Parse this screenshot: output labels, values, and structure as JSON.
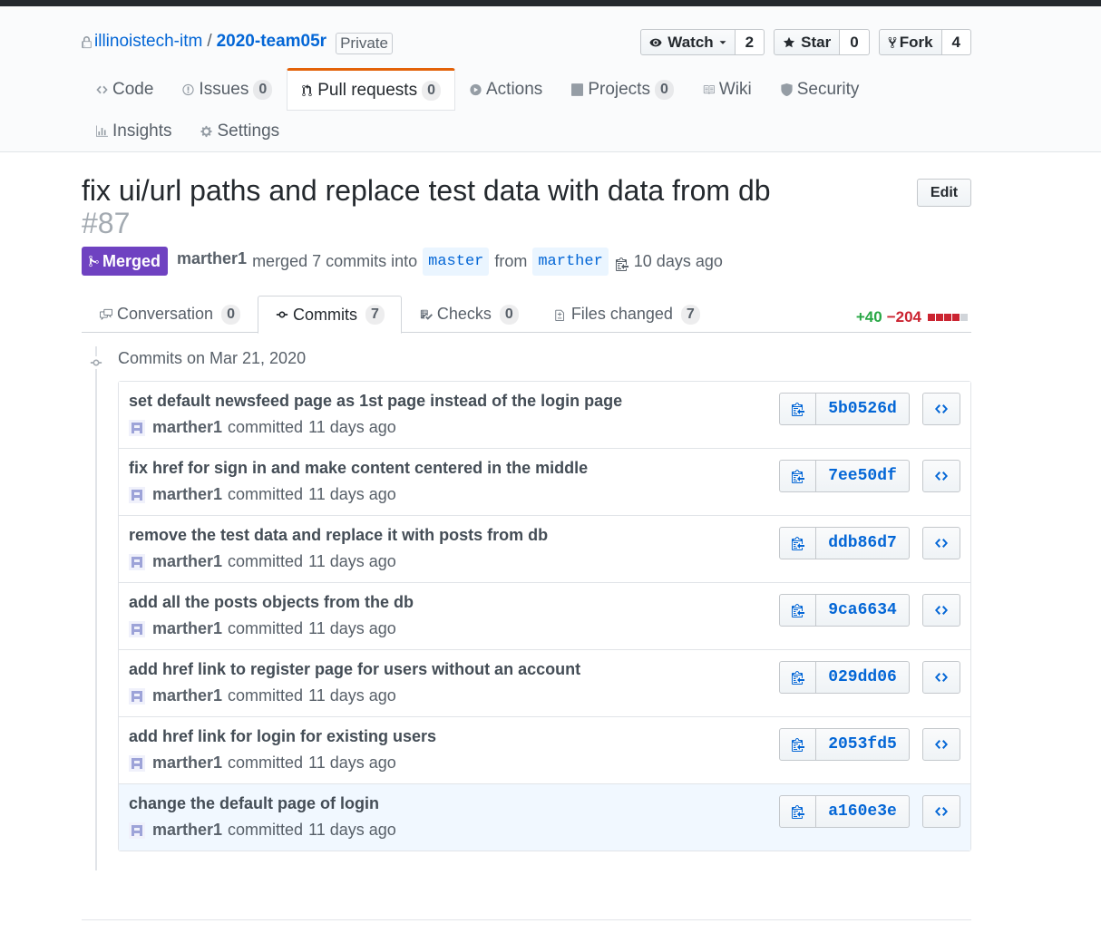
{
  "repo": {
    "owner": "illinoistech-itm",
    "separator": "/",
    "name": "2020-team05r",
    "visibility": "Private"
  },
  "social": {
    "watch": {
      "label": "Watch",
      "count": "2"
    },
    "star": {
      "label": "Star",
      "count": "0"
    },
    "fork": {
      "label": "Fork",
      "count": "4"
    }
  },
  "nav": {
    "code": "Code",
    "issues": {
      "label": "Issues",
      "count": "0"
    },
    "pulls": {
      "label": "Pull requests",
      "count": "0"
    },
    "actions": "Actions",
    "projects": {
      "label": "Projects",
      "count": "0"
    },
    "wiki": "Wiki",
    "security": "Security",
    "insights": "Insights",
    "settings": "Settings"
  },
  "pr": {
    "title": "fix ui/url paths and replace test data with data from db",
    "number": "#87",
    "edit_label": "Edit",
    "state": "Merged",
    "author": "marther1",
    "merged_text": "merged 7 commits into",
    "base_branch": "master",
    "from_text": "from",
    "head_branch": "marther",
    "time_ago": "10 days ago"
  },
  "tabs": {
    "conversation": {
      "label": "Conversation",
      "count": "0"
    },
    "commits": {
      "label": "Commits",
      "count": "7"
    },
    "checks": {
      "label": "Checks",
      "count": "0"
    },
    "files": {
      "label": "Files changed",
      "count": "7"
    }
  },
  "diffstat": {
    "additions": "+40",
    "deletions": "−204",
    "colors": {
      "add": "#28a745",
      "del": "#cb2431",
      "neutral": "#d1d5da"
    }
  },
  "commit_group": {
    "title": "Commits on Mar 21, 2020",
    "committed_text": "committed",
    "commits": [
      {
        "message": "set default newsfeed page as 1st page instead of the login page",
        "author": "marther1",
        "time": "11 days ago",
        "sha": "5b0526d"
      },
      {
        "message": "fix href for sign in and make content centered in the middle",
        "author": "marther1",
        "time": "11 days ago",
        "sha": "7ee50df"
      },
      {
        "message": "remove the test data and replace it with posts from db",
        "author": "marther1",
        "time": "11 days ago",
        "sha": "ddb86d7"
      },
      {
        "message": "add all the posts objects from the db",
        "author": "marther1",
        "time": "11 days ago",
        "sha": "9ca6634"
      },
      {
        "message": "add href link to register page for users without an account",
        "author": "marther1",
        "time": "11 days ago",
        "sha": "029dd06"
      },
      {
        "message": "add href link for login for existing users",
        "author": "marther1",
        "time": "11 days ago",
        "sha": "2053fd5"
      },
      {
        "message": "change the default page of login",
        "author": "marther1",
        "time": "11 days ago",
        "sha": "a160e3e"
      }
    ]
  },
  "colors": {
    "link": "#0366d6",
    "merged": "#6f42c1",
    "tab_accent": "#e36209"
  }
}
